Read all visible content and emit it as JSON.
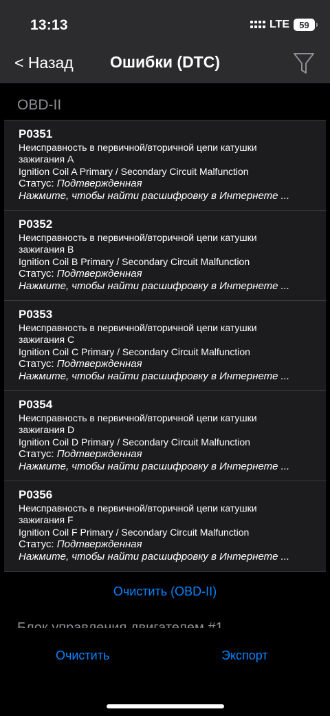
{
  "status_bar": {
    "time": "13:13",
    "network": "LTE",
    "battery": "59"
  },
  "nav": {
    "back_label": "< Назад",
    "title": "Ошибки (DTC)",
    "filter_icon": "filter-icon"
  },
  "section": {
    "title": "OBD-II",
    "next_title": "Блок управления двигателем #1"
  },
  "codes": [
    {
      "code": "P0351",
      "desc_ru": "Неисправность в первичной/вторичной цепи катушки зажигания А",
      "desc_en": "Ignition Coil A Primary / Secondary Circuit Malfunction",
      "status_label": "Статус: ",
      "status_value": "Подтвержденная",
      "hint": "Нажмите, чтобы найти расшифровку в Интернете ..."
    },
    {
      "code": "P0352",
      "desc_ru": "Неисправность в первичной/вторичной цепи катушки зажигания В",
      "desc_en": "Ignition Coil B Primary / Secondary Circuit Malfunction",
      "status_label": "Статус: ",
      "status_value": "Подтвержденная",
      "hint": "Нажмите, чтобы найти расшифровку в Интернете ..."
    },
    {
      "code": "P0353",
      "desc_ru": "Неисправность в первичной/вторичной цепи катушки зажигания С",
      "desc_en": "Ignition Coil C Primary / Secondary Circuit Malfunction",
      "status_label": "Статус: ",
      "status_value": "Подтвержденная",
      "hint": "Нажмите, чтобы найти расшифровку в Интернете ..."
    },
    {
      "code": "P0354",
      "desc_ru": "Неисправность в первичной/вторичной цепи катушки зажигания D",
      "desc_en": "Ignition Coil D Primary / Secondary Circuit Malfunction",
      "status_label": "Статус: ",
      "status_value": "Подтвержденная",
      "hint": "Нажмите, чтобы найти расшифровку в Интернете ..."
    },
    {
      "code": "P0356",
      "desc_ru": "Неисправность в первичной/вторичной цепи катушки зажигания F",
      "desc_en": "Ignition Coil F Primary / Secondary Circuit Malfunction",
      "status_label": "Статус: ",
      "status_value": "Подтвержденная",
      "hint": "Нажмите, чтобы найти расшифровку в Интернете ..."
    }
  ],
  "actions": {
    "clear_section": "Очистить (OBD-II)",
    "clear_all": "Очистить",
    "export": "Экспорт"
  },
  "colors": {
    "accent": "#0a84ff",
    "header_bg": "#2c2c2e",
    "cell_bg": "#1c1c1e"
  }
}
